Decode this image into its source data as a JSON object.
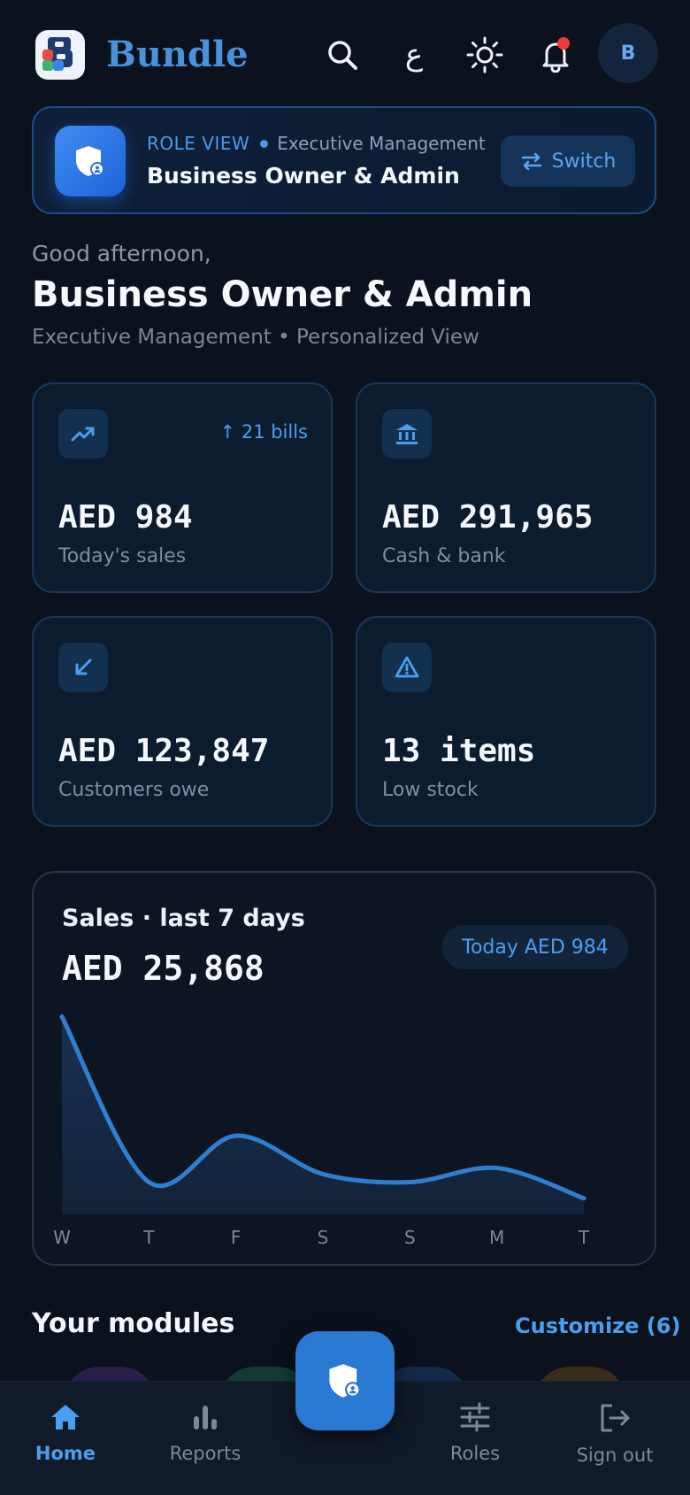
{
  "app": {
    "brand": "Bundle",
    "language_toggle": "ع",
    "avatar_initial": "B"
  },
  "role_card": {
    "label": "ROLE VIEW",
    "department": "Executive Management",
    "role": "Business Owner & Admin",
    "switch_label": "Switch"
  },
  "greeting": {
    "salutation": "Good afternoon,",
    "name": "Business Owner & Admin",
    "subtitle": "Executive Management • Personalized View"
  },
  "stats": [
    {
      "value": "AED 984",
      "label": "Today's sales",
      "badge": "21 bills",
      "icon": "trending-up-icon"
    },
    {
      "value": "AED 291,965",
      "label": "Cash & bank",
      "icon": "bank-icon"
    },
    {
      "value": "AED 123,847",
      "label": "Customers owe",
      "icon": "arrow-down-left-icon"
    },
    {
      "value": "13 items",
      "label": "Low stock",
      "icon": "warning-icon"
    }
  ],
  "sales_card": {
    "title": "Sales · last 7 days",
    "total": "AED 25,868",
    "today_pill": "Today AED 984"
  },
  "chart_data": {
    "type": "area",
    "categories": [
      "W",
      "T",
      "F",
      "S",
      "S",
      "M",
      "T"
    ],
    "values": [
      9800,
      1600,
      3900,
      2000,
      1600,
      2300,
      800
    ],
    "ylim": [
      0,
      10000
    ],
    "grid": false,
    "line_color": "#2f7fd0"
  },
  "modules": {
    "title": "Your modules",
    "customize_label": "Customize (6)"
  },
  "bottom_nav": {
    "items": [
      {
        "label": "Home",
        "icon": "home-icon",
        "active": true
      },
      {
        "label": "Reports",
        "icon": "bar-chart-icon",
        "active": false
      },
      {
        "label": "Roles",
        "icon": "sliders-icon",
        "active": false
      },
      {
        "label": "Sign out",
        "icon": "sign-out-icon",
        "active": false
      }
    ]
  },
  "colors": {
    "accent": "#4b9ff2",
    "background": "#0b111d",
    "notification": "#ef3b3b"
  }
}
